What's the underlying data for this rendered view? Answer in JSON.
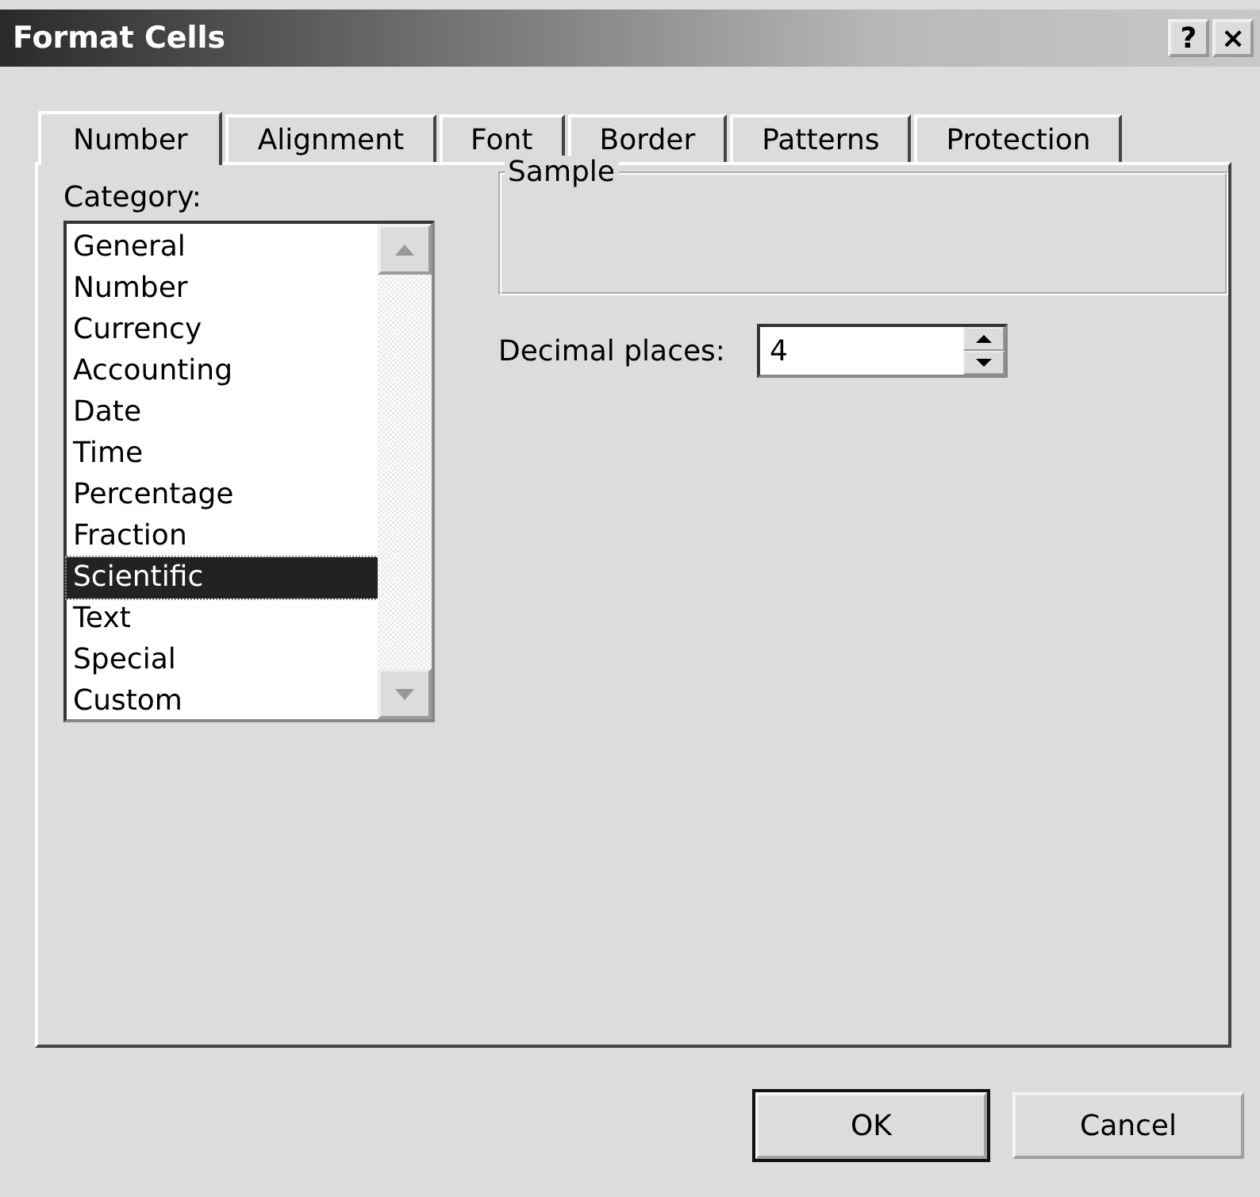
{
  "window": {
    "title": "Format Cells",
    "help": "?",
    "close": "×"
  },
  "tabs": [
    {
      "label": "Number",
      "selected": true
    },
    {
      "label": "Alignment",
      "selected": false
    },
    {
      "label": "Font",
      "selected": false
    },
    {
      "label": "Border",
      "selected": false
    },
    {
      "label": "Patterns",
      "selected": false
    },
    {
      "label": "Protection",
      "selected": false
    }
  ],
  "category": {
    "label": "Category:",
    "items": [
      {
        "label": "General",
        "selected": false
      },
      {
        "label": "Number",
        "selected": false
      },
      {
        "label": "Currency",
        "selected": false
      },
      {
        "label": "Accounting",
        "selected": false
      },
      {
        "label": "Date",
        "selected": false
      },
      {
        "label": "Time",
        "selected": false
      },
      {
        "label": "Percentage",
        "selected": false
      },
      {
        "label": "Fraction",
        "selected": false
      },
      {
        "label": "Scientific",
        "selected": true
      },
      {
        "label": "Text",
        "selected": false
      },
      {
        "label": "Special",
        "selected": false
      },
      {
        "label": "Custom",
        "selected": false
      }
    ]
  },
  "sample": {
    "label": "Sample"
  },
  "decimal_places": {
    "label": "Decimal places:",
    "value": "4"
  },
  "buttons": [
    {
      "label": "OK",
      "default": true
    },
    {
      "label": "Cancel",
      "default": false
    }
  ]
}
